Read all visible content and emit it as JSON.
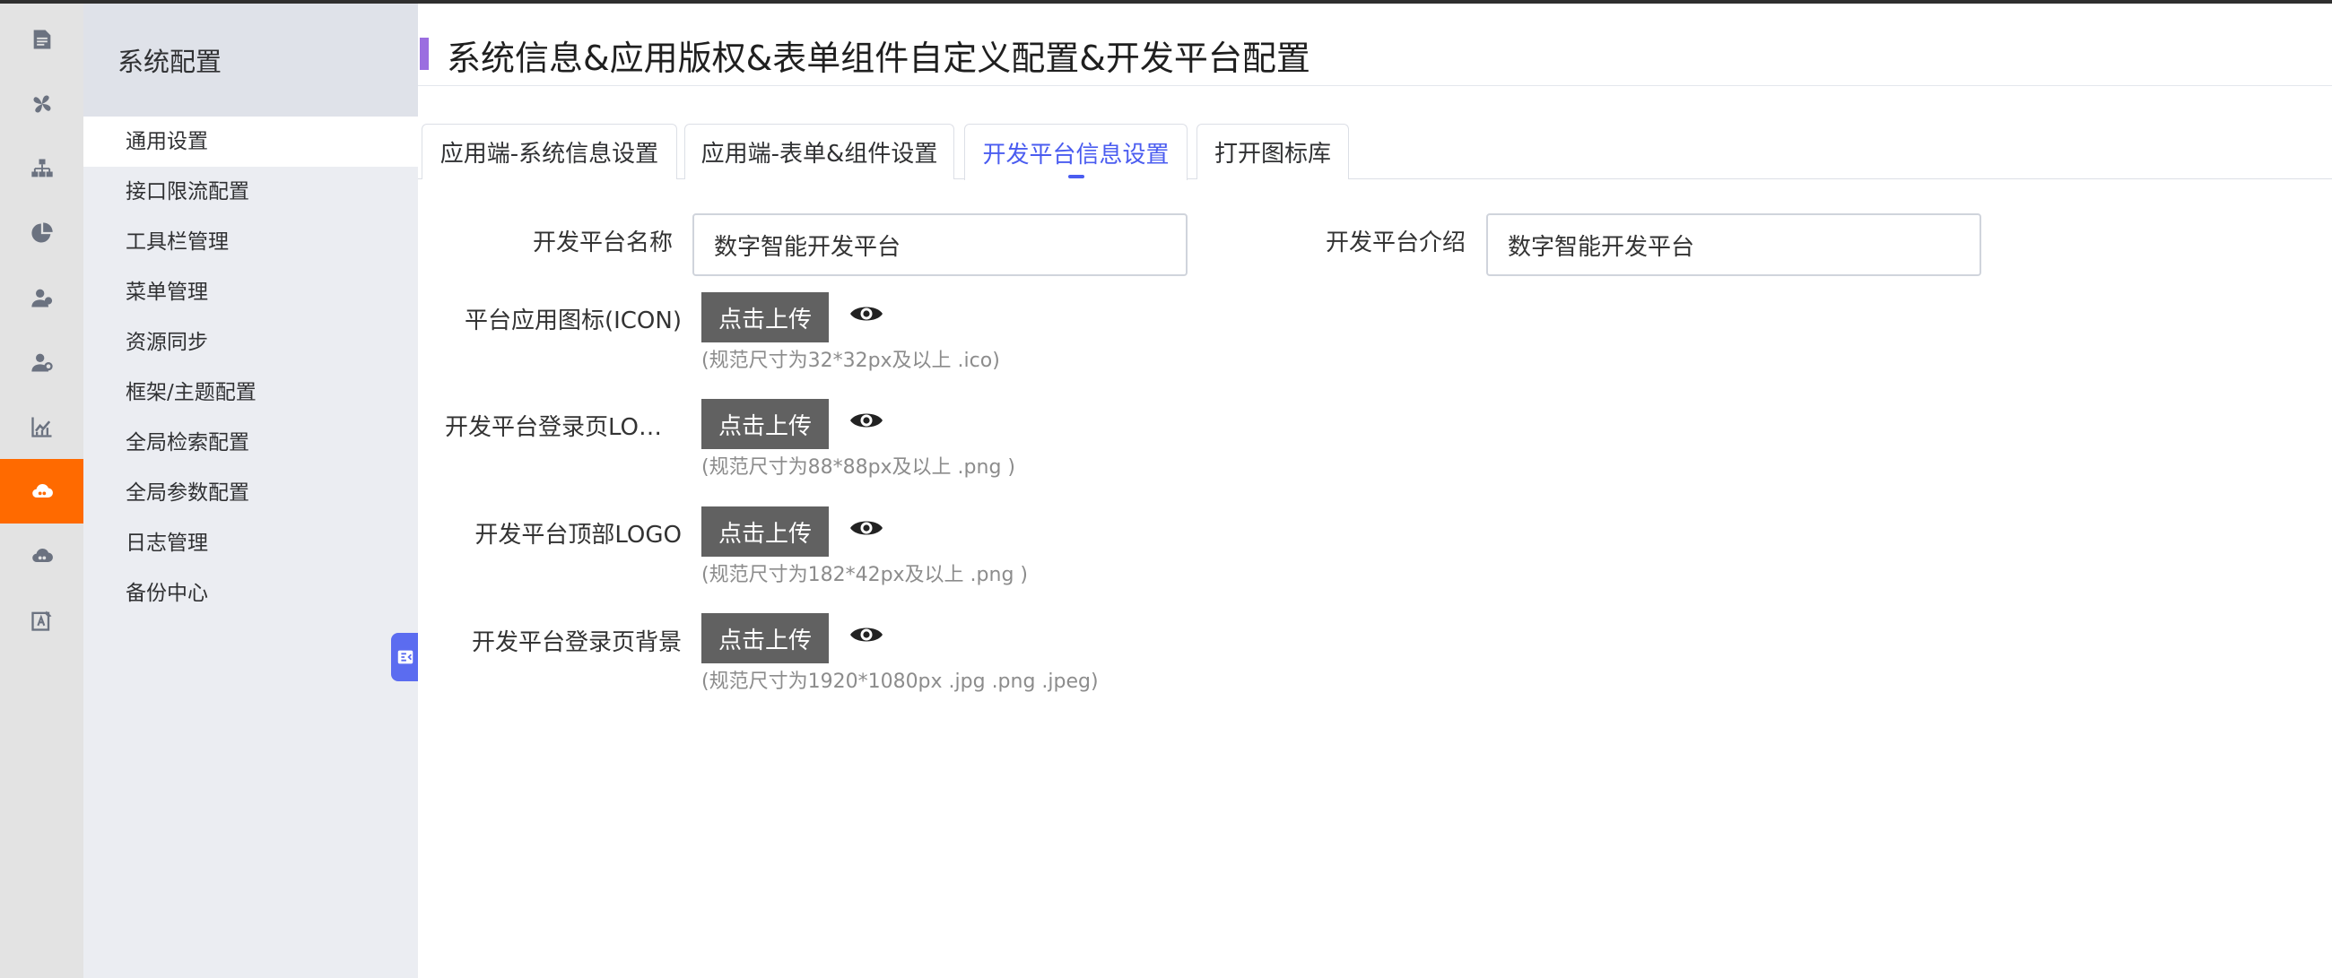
{
  "rail": {
    "icons": [
      "document-icon",
      "fan-icon",
      "org-tree-icon",
      "pie-chart-icon",
      "user-group-icon",
      "user-settings-icon",
      "trend-chart-icon",
      "cloud-settings-icon",
      "cloud-icon",
      "app-edit-icon"
    ],
    "active_index": 7,
    "accent_color": "#ff6a00"
  },
  "subnav": {
    "title": "系统配置",
    "items": [
      {
        "label": "通用设置"
      },
      {
        "label": "接口限流配置"
      },
      {
        "label": "工具栏管理"
      },
      {
        "label": "菜单管理"
      },
      {
        "label": "资源同步"
      },
      {
        "label": "框架/主题配置"
      },
      {
        "label": "全局检索配置"
      },
      {
        "label": "全局参数配置"
      },
      {
        "label": "日志管理"
      },
      {
        "label": "备份中心"
      }
    ],
    "active_index": 0
  },
  "header": {
    "title": "系统信息&应用版权&表单组件自定义配置&开发平台配置",
    "accent_color": "#9b6ee0"
  },
  "tabs": [
    {
      "label": "应用端-系统信息设置"
    },
    {
      "label": "应用端-表单&组件设置"
    },
    {
      "label": "开发平台信息设置"
    },
    {
      "label": "打开图标库"
    }
  ],
  "active_tab": 2,
  "active_tab_color": "#4a5cf0",
  "form": {
    "name_label": "开发平台名称",
    "name_value": "数字智能开发平台",
    "intro_label": "开发平台介绍",
    "intro_value": "数字智能开发平台",
    "uploads": [
      {
        "label": "平台应用图标(ICON)",
        "button": "点击上传",
        "hint": "(规范尺寸为32*32px及以上 .ico)"
      },
      {
        "label": "开发平台登录页LOGO",
        "button": "点击上传",
        "hint": "(规范尺寸为88*88px及以上 .png )"
      },
      {
        "label": "开发平台顶部LOGO",
        "button": "点击上传",
        "hint": "(规范尺寸为182*42px及以上 .png )"
      },
      {
        "label": "开发平台登录页背景",
        "button": "点击上传",
        "hint": "(规范尺寸为1920*1080px .jpg .png .jpeg)"
      }
    ]
  }
}
